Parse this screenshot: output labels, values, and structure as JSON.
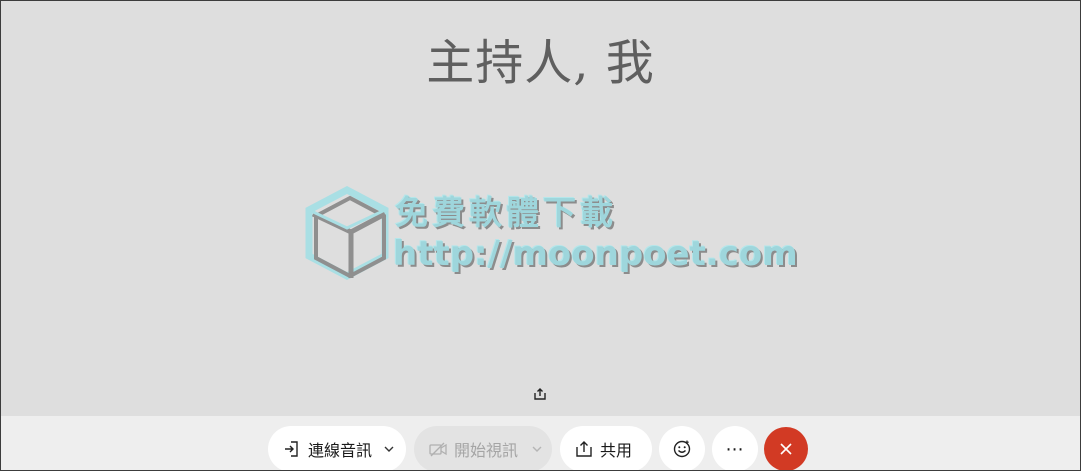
{
  "stage": {
    "host_name": "主持人, 我"
  },
  "watermark": {
    "line1": "免費軟體下載",
    "line2": "http://moonpoet.com"
  },
  "controls": {
    "audio_label": "連線音訊",
    "video_label": "開始視訊",
    "share_label": "共用",
    "more_label": "⋯"
  },
  "icons": {
    "audio": "connect-audio-icon",
    "video": "video-camera-off-icon",
    "share": "share-upload-icon",
    "emoji": "smiley-icon",
    "more": "more-horizontal-icon",
    "leave": "close-x-icon",
    "share_indicator": "share-indicator-icon"
  },
  "colors": {
    "stage_bg": "#dedede",
    "bar_bg": "#eeeeee",
    "leave_red": "#d23a24",
    "watermark_teal": "#9ed6dc"
  }
}
